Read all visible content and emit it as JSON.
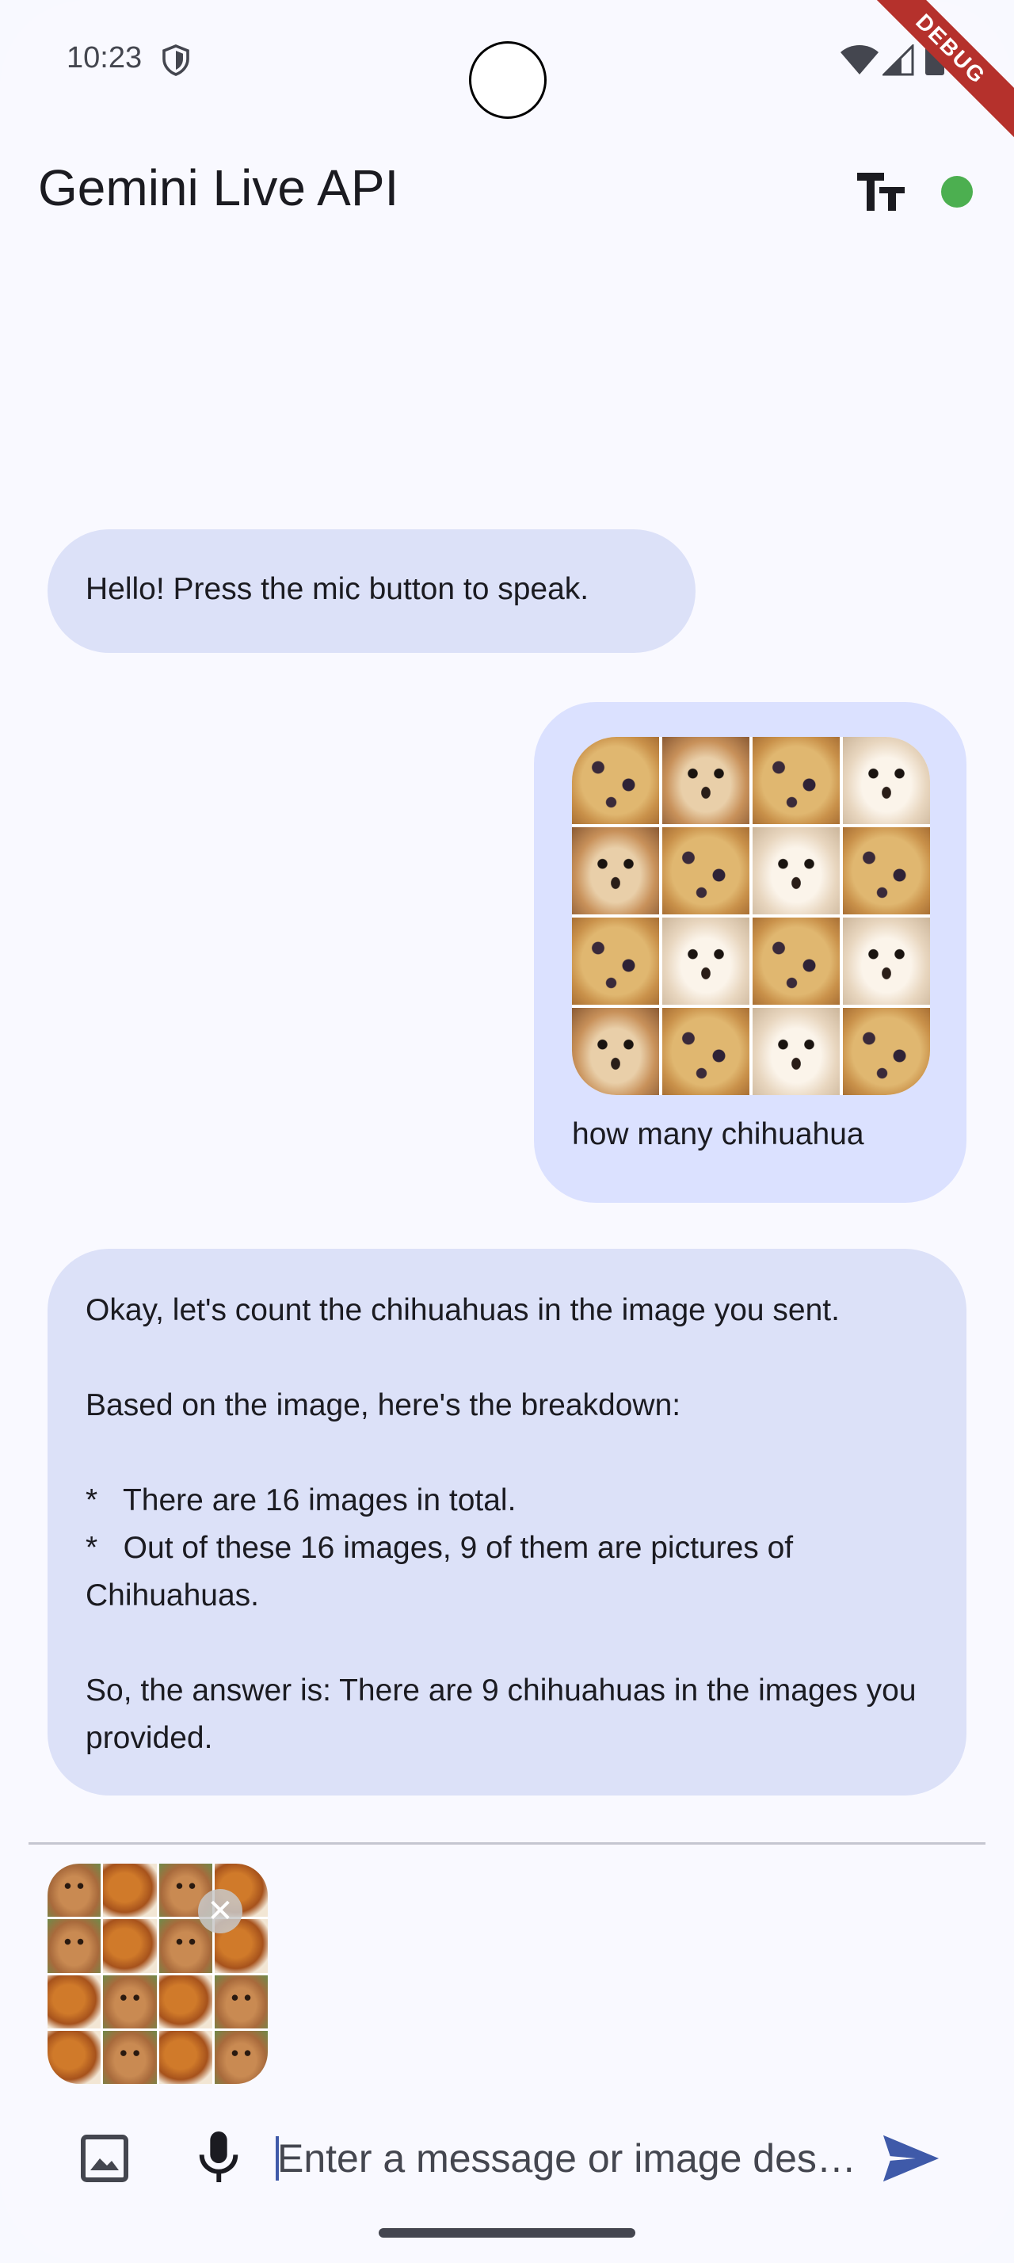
{
  "status_bar": {
    "time": "10:23",
    "debug_label": "DEBUG"
  },
  "app_bar": {
    "title": "Gemini Live API",
    "connection_status_color": "#4caf50"
  },
  "messages": [
    {
      "role": "model",
      "text": "Hello! Press the mic button to speak."
    },
    {
      "role": "user",
      "image": "muffin-chihuahua-grid",
      "text": "how many chihuahua"
    },
    {
      "role": "model",
      "lines": [
        "Okay, let's count the chihuahuas in the image you sent.",
        "",
        "Based on the image, here's the breakdown:",
        "",
        "*   There are 16 images in total.",
        "*   Out of these 16 images, 9 of them are pictures of Chihuahuas.",
        "",
        "So, the answer is: There are 9 chihuahuas in the images you provided."
      ]
    }
  ],
  "attachment": {
    "image": "poodle-fried-chicken-grid",
    "remove_label": "✕"
  },
  "input": {
    "placeholder": "Enter a message or image des…",
    "value": ""
  },
  "colors": {
    "bubble": "#dce1f8",
    "accent": "#3f5aa9",
    "background": "#f9f9ff"
  }
}
